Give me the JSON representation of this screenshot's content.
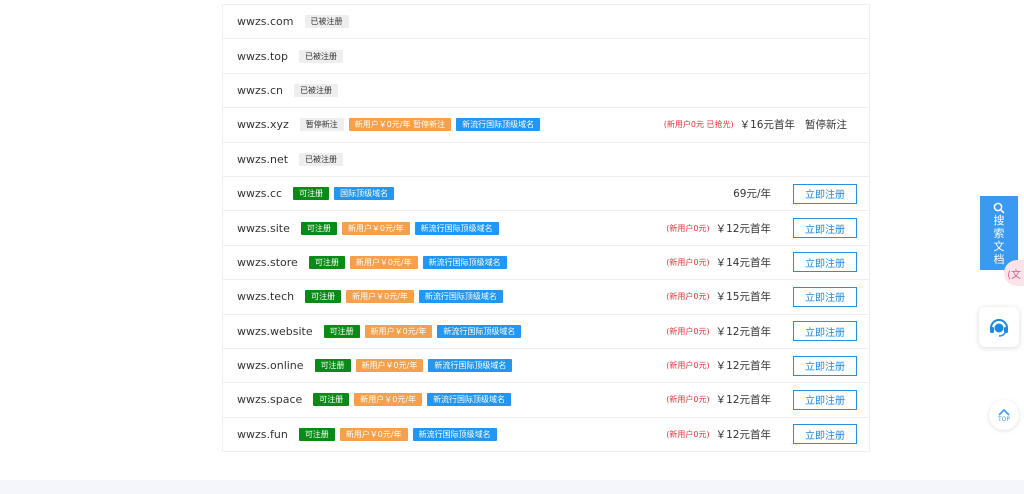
{
  "domains": [
    {
      "name": "wwzs.com",
      "tags": [
        {
          "text": "已被注册",
          "style": "gray"
        }
      ]
    },
    {
      "name": "wwzs.top",
      "tags": [
        {
          "text": "已被注册",
          "style": "gray"
        }
      ]
    },
    {
      "name": "wwzs.cn",
      "tags": [
        {
          "text": "已被注册",
          "style": "gray"
        }
      ]
    },
    {
      "name": "wwzs.xyz",
      "tags": [
        {
          "text": "暂停新注",
          "style": "gray"
        },
        {
          "text": "新用户￥0元/年 暂停新注",
          "style": "orange"
        },
        {
          "text": "新流行国际顶级域名",
          "style": "blue"
        }
      ],
      "promo": "(新用户0元 已抢光)",
      "price": "￥16元首年",
      "status": "暂停新注"
    },
    {
      "name": "wwzs.net",
      "tags": [
        {
          "text": "已被注册",
          "style": "gray"
        }
      ]
    },
    {
      "name": "wwzs.cc",
      "tags": [
        {
          "text": "可注册",
          "style": "green"
        },
        {
          "text": "国际顶级域名",
          "style": "blue"
        }
      ],
      "price": "69元/年",
      "button": "立即注册"
    },
    {
      "name": "wwzs.site",
      "tags": [
        {
          "text": "可注册",
          "style": "green"
        },
        {
          "text": "新用户￥0元/年",
          "style": "orange"
        },
        {
          "text": "新流行国际顶级域名",
          "style": "blue"
        }
      ],
      "promo": "(新用户0元)",
      "price": "￥12元首年",
      "button": "立即注册"
    },
    {
      "name": "wwzs.store",
      "tags": [
        {
          "text": "可注册",
          "style": "green"
        },
        {
          "text": "新用户￥0元/年",
          "style": "orange"
        },
        {
          "text": "新流行国际顶级域名",
          "style": "blue"
        }
      ],
      "promo": "(新用户0元)",
      "price": "￥14元首年",
      "button": "立即注册"
    },
    {
      "name": "wwzs.tech",
      "tags": [
        {
          "text": "可注册",
          "style": "green"
        },
        {
          "text": "新用户￥0元/年",
          "style": "orange"
        },
        {
          "text": "新流行国际顶级域名",
          "style": "blue"
        }
      ],
      "promo": "(新用户0元)",
      "price": "￥15元首年",
      "button": "立即注册"
    },
    {
      "name": "wwzs.website",
      "tags": [
        {
          "text": "可注册",
          "style": "green"
        },
        {
          "text": "新用户￥0元/年",
          "style": "orange"
        },
        {
          "text": "新流行国际顶级域名",
          "style": "blue"
        }
      ],
      "promo": "(新用户0元)",
      "price": "￥12元首年",
      "button": "立即注册"
    },
    {
      "name": "wwzs.online",
      "tags": [
        {
          "text": "可注册",
          "style": "green"
        },
        {
          "text": "新用户￥0元/年",
          "style": "orange"
        },
        {
          "text": "新流行国际顶级域名",
          "style": "blue"
        }
      ],
      "promo": "(新用户0元)",
      "price": "￥12元首年",
      "button": "立即注册"
    },
    {
      "name": "wwzs.space",
      "tags": [
        {
          "text": "可注册",
          "style": "green"
        },
        {
          "text": "新用户￥0元/年",
          "style": "orange"
        },
        {
          "text": "新流行国际顶级域名",
          "style": "blue"
        }
      ],
      "promo": "(新用户0元)",
      "price": "￥12元首年",
      "button": "立即注册"
    },
    {
      "name": "wwzs.fun",
      "tags": [
        {
          "text": "可注册",
          "style": "green"
        },
        {
          "text": "新用户￥0元/年",
          "style": "orange"
        },
        {
          "text": "新流行国际顶级域名",
          "style": "blue"
        }
      ],
      "promo": "(新用户0元)",
      "price": "￥12元首年",
      "button": "立即注册"
    }
  ],
  "sidebar": {
    "search_docs": {
      "label": "搜索文档",
      "icon": "search-icon"
    },
    "pink_tab": {
      "label": "⟨文"
    },
    "customer_service": {
      "icon": "headset-icon"
    },
    "back_to_top": {
      "label": "TOP",
      "icon": "arrow-up-icon"
    }
  },
  "colors": {
    "accent": "#1e88e5",
    "available": "#0a8a16",
    "promo_orange": "#f5a04c",
    "tag_blue": "#2196f3",
    "promo_red": "#e8343a"
  }
}
